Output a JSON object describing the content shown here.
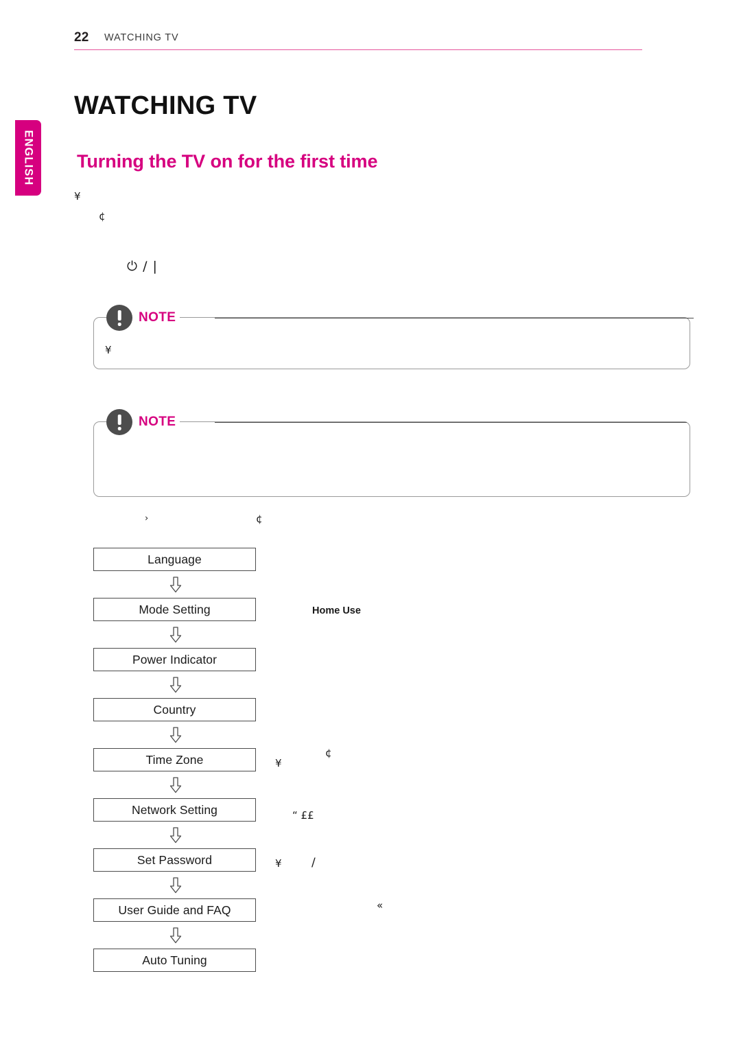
{
  "colors": {
    "accent": "#d6007f",
    "rule": "#e5559c",
    "text": "#1a1a1a",
    "box_border": "#4c4c4c",
    "note_border": "#9a9a9a",
    "note_icon": "#4d4d4d"
  },
  "side_tab": {
    "label": "ENGLISH"
  },
  "header": {
    "page_number": "22",
    "section": "WATCHING TV"
  },
  "title": "WATCHING TV",
  "subtitle": "Turning the TV on for the first time",
  "body_markers": [
    {
      "name": "bullet-marker-1",
      "text": "¥"
    },
    {
      "name": "sub-bullet-marker-1",
      "text": "¢"
    },
    {
      "name": "power-button-symbol",
      "text": "⏻ / |"
    }
  ],
  "notes": [
    {
      "name": "note-box-1",
      "label": "NOTE",
      "icon": "exclamation-circle-icon",
      "markers": [
        {
          "name": "note-bullet-marker",
          "text": "¥"
        }
      ]
    },
    {
      "name": "note-box-2",
      "label": "NOTE",
      "icon": "exclamation-circle-icon",
      "markers": []
    }
  ],
  "setup_flow": {
    "arrow_glyph": "⇩",
    "steps": [
      "Language",
      "Mode Setting",
      "Power Indicator",
      "Country",
      "Time Zone",
      "Network Setting",
      "Set Password",
      "User Guide and FAQ",
      "Auto Tuning"
    ]
  },
  "annotations": [
    {
      "name": "annotation-caret",
      "text": "›"
    },
    {
      "name": "annotation-sub-bullet-a",
      "text": "¢"
    },
    {
      "name": "annotation-home-use",
      "text": "Home Use"
    },
    {
      "name": "annotation-sub-bullet-b",
      "text": "¢"
    },
    {
      "name": "annotation-bullet-a",
      "text": "¥"
    },
    {
      "name": "annotation-pounds",
      "text": "“ ££"
    },
    {
      "name": "annotation-bullet-b",
      "text": "¥"
    },
    {
      "name": "annotation-slash",
      "text": "/"
    },
    {
      "name": "annotation-guillemet",
      "text": "«"
    }
  ]
}
